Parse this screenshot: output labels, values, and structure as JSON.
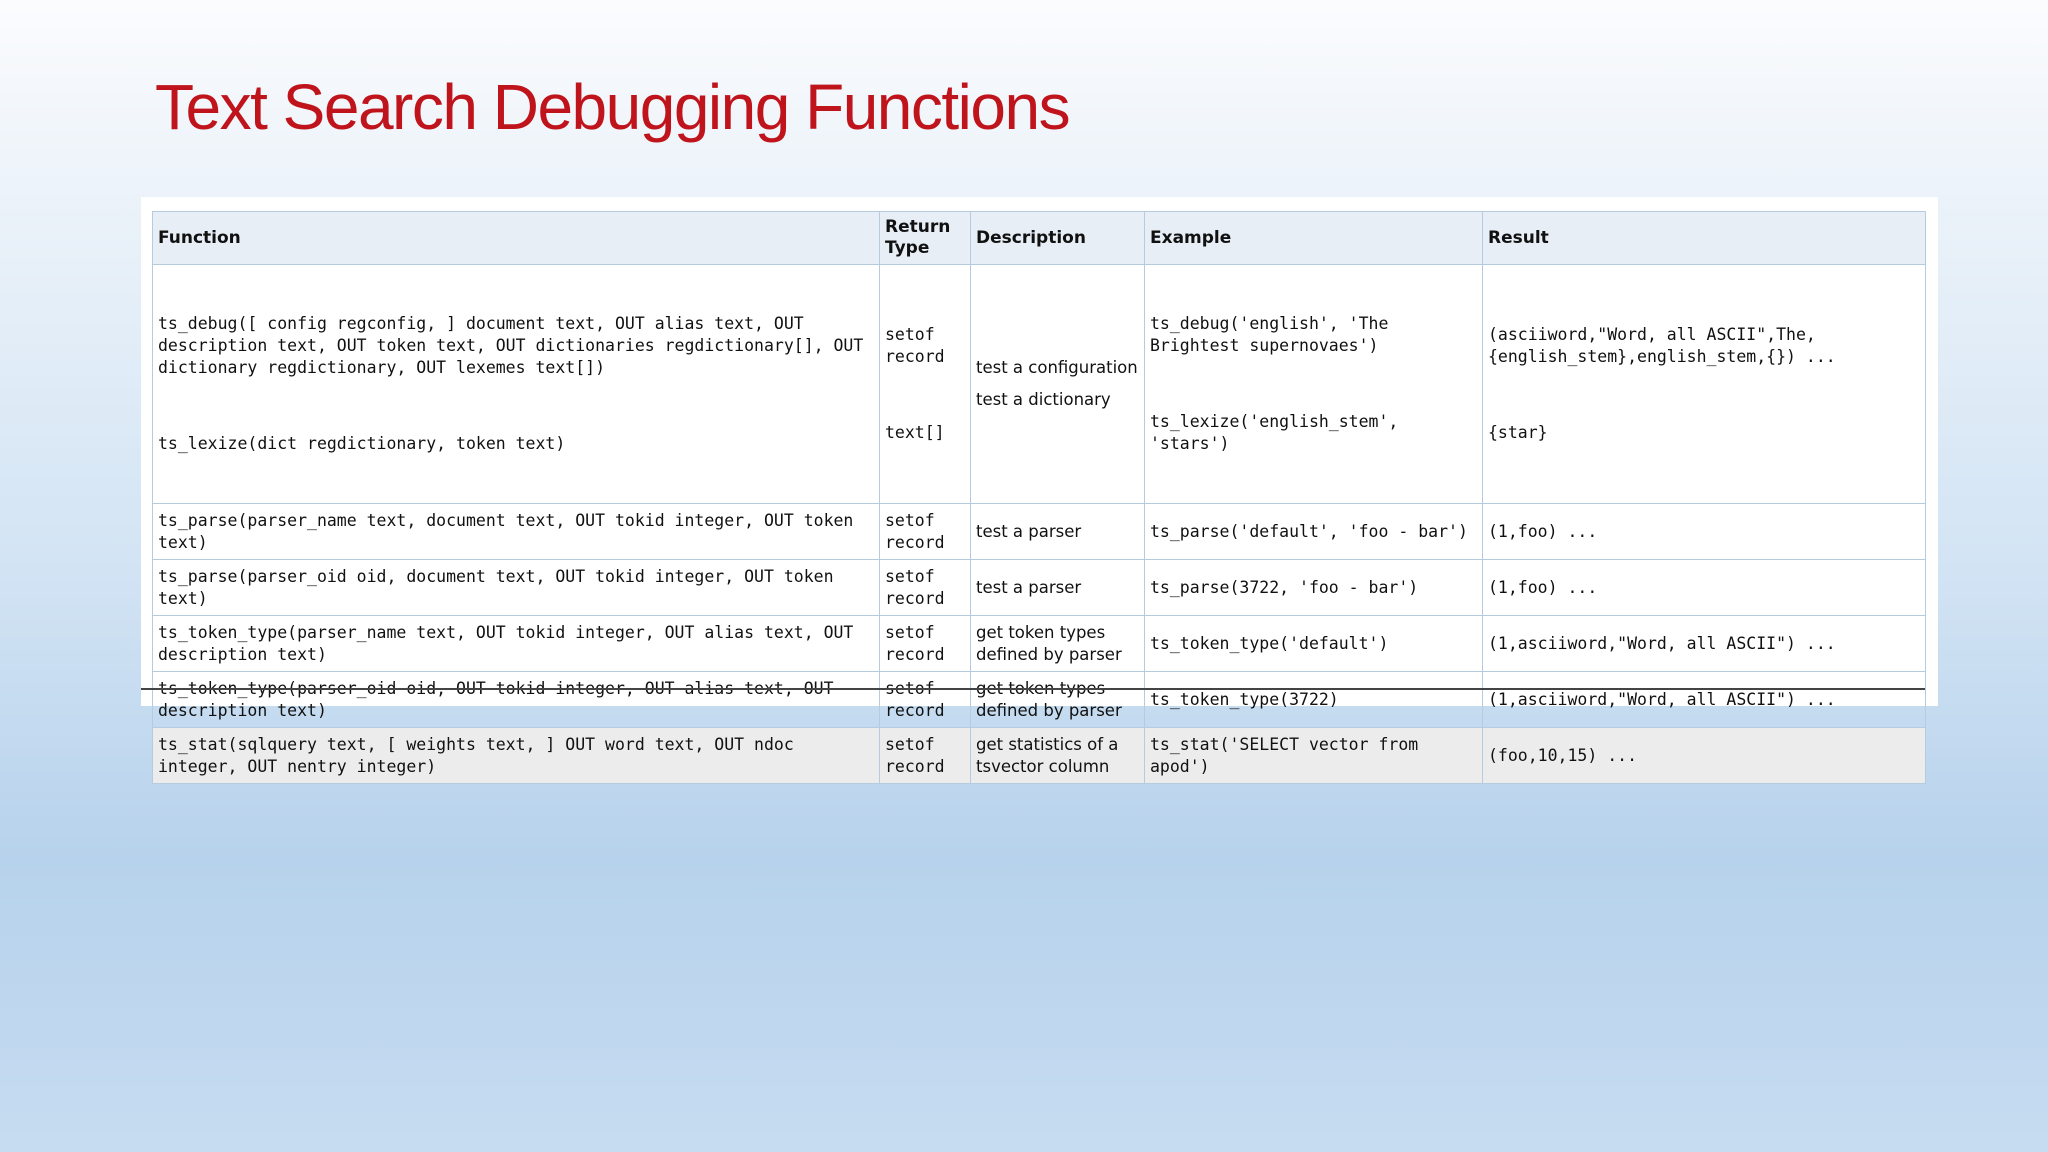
{
  "title": "Text Search Debugging Functions",
  "table": {
    "headers": {
      "function": "Function",
      "return_type": "Return Type",
      "description": "Description",
      "example": "Example",
      "result": "Result"
    },
    "rows": [
      {
        "function": "ts_debug([ config regconfig, ] document text, OUT alias text, OUT description text, OUT token text, OUT dictionaries regdictionary[], OUT dictionary regdictionary, OUT lexemes text[])",
        "return_type": "setof record",
        "description": "test a configuration",
        "example": "ts_debug('english', 'The Brightest supernovaes')",
        "result": "(asciiword,\"Word, all ASCII\",The,{english_stem},english_stem,{}) ...",
        "function_2": "ts_lexize(dict regdictionary, token text)",
        "return_type_2": "text[]",
        "description_2": "test a dictionary",
        "example_2": "ts_lexize('english_stem', 'stars')",
        "result_2": "{star}"
      },
      {
        "function": "ts_parse(parser_name text, document text, OUT tokid integer, OUT token text)",
        "return_type": "setof record",
        "description": "test a parser",
        "example": "ts_parse('default', 'foo - bar')",
        "result": "(1,foo) ..."
      },
      {
        "function": "ts_parse(parser_oid oid, document text, OUT tokid integer, OUT token text)",
        "return_type": "setof record",
        "description": "test a parser",
        "example": "ts_parse(3722, 'foo - bar')",
        "result": "(1,foo) ..."
      },
      {
        "function": "ts_token_type(parser_name text, OUT tokid integer, OUT alias text, OUT description text)",
        "return_type": "setof record",
        "description": "get token types defined by parser",
        "example": "ts_token_type('default')",
        "result": "(1,asciiword,\"Word, all ASCII\") ..."
      },
      {
        "function": "ts_token_type(parser_oid oid, OUT tokid integer, OUT alias text, OUT description text)",
        "return_type": "setof record",
        "description": "get token types defined by parser",
        "example": "ts_token_type(3722)",
        "result": "(1,asciiword,\"Word, all ASCII\") ..."
      },
      {
        "function": "ts_stat(sqlquery text, [ weights text, ] OUT word text, OUT ndoc integer, OUT nentry integer)",
        "return_type": "setof record",
        "description": "get statistics of a tsvector column",
        "example": "ts_stat('SELECT vector from apod')",
        "result": "(foo,10,15) ..."
      }
    ]
  }
}
